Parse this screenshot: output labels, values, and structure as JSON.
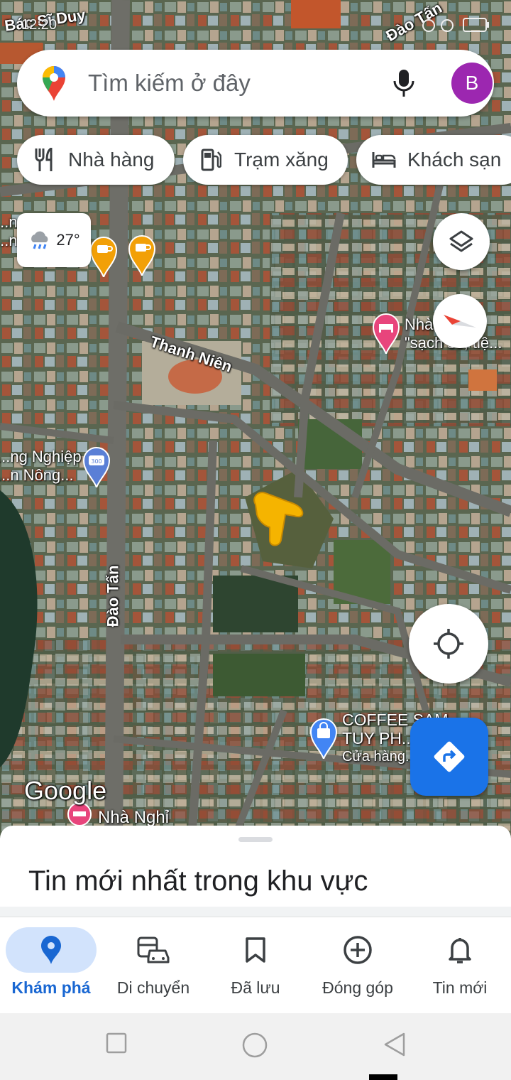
{
  "status": {
    "time": "12:20"
  },
  "search": {
    "placeholder": "Tìm kiếm ở đây",
    "avatar_letter": "B"
  },
  "chips": [
    {
      "label": "Nhà hàng",
      "icon": "restaurant-icon"
    },
    {
      "label": "Trạm xăng",
      "icon": "gas-station-icon"
    },
    {
      "label": "Khách sạn",
      "icon": "hotel-icon"
    }
  ],
  "weather": {
    "temp": "27°",
    "icon": "rain-cloud-icon"
  },
  "map": {
    "streets": [
      "Bác Sĩ Duy",
      "Đào Tấn",
      "Thanh Niên",
      "Đào Tấn"
    ],
    "pois": [
      {
        "text": "Nhà ...",
        "sub": "\"sạch sẽ, tiệ...",
        "type": "hotel"
      },
      {
        "text": "...ng Nghiệp",
        "sub": "...n Nông...",
        "type": "bank"
      },
      {
        "text": "COFFEE SAM",
        "sub": "TUY PH...",
        "sub2": "Cửa hàng...",
        "type": "shop"
      },
      {
        "text": "Nhà Nghỉ",
        "type": "hotel"
      },
      {
        "text": "...n Cơ...",
        "sub": "...ng",
        "type": "label"
      }
    ],
    "watermark": "Google"
  },
  "sheet": {
    "title": "Tin mới nhất trong khu vực"
  },
  "bottom_nav": [
    {
      "label": "Khám phá",
      "icon": "explore-pin-icon",
      "active": true
    },
    {
      "label": "Di chuyển",
      "icon": "commute-icon",
      "active": false
    },
    {
      "label": "Đã lưu",
      "icon": "bookmark-icon",
      "active": false
    },
    {
      "label": "Đóng góp",
      "icon": "add-circle-icon",
      "active": false
    },
    {
      "label": "Tin mới",
      "icon": "bell-icon",
      "active": false
    }
  ],
  "colors": {
    "accent": "#1a73e8",
    "avatar": "#9c27b0",
    "active_nav_bg": "#d2e3fc"
  }
}
